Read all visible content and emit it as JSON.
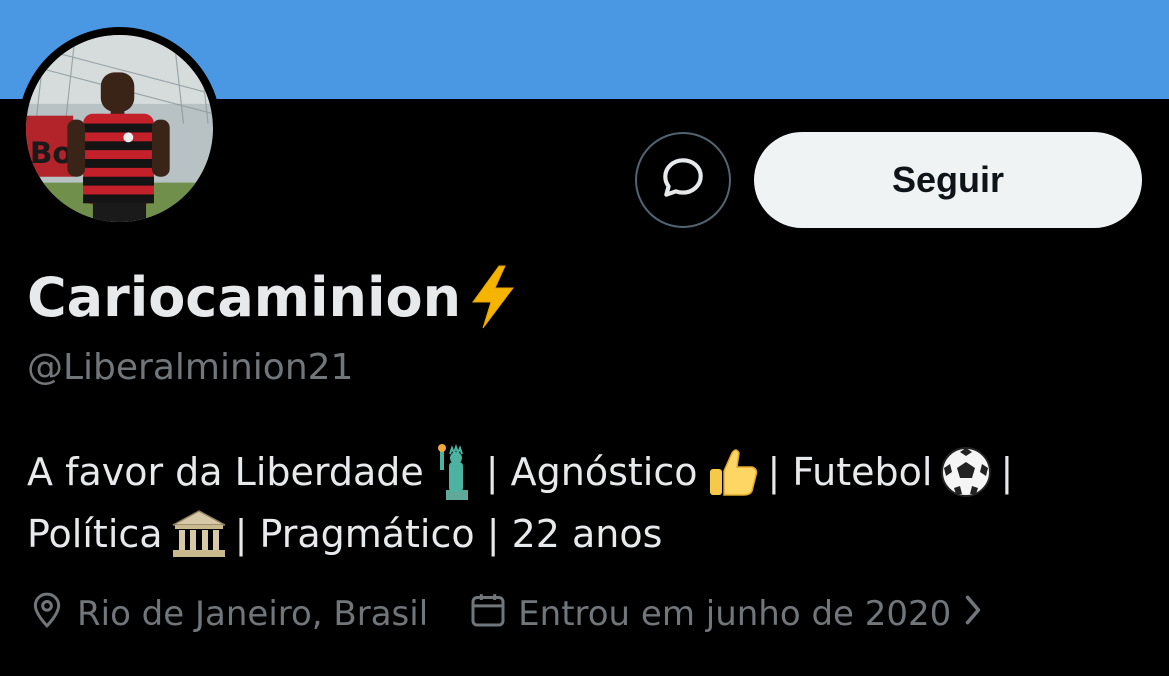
{
  "profile": {
    "display_name": "Cariocaminion",
    "name_emoji": "lightning-bolt-emoji",
    "handle": "@Liberalminion21",
    "avatar_icon": "profile-photo",
    "banner_color": "#4a98e4"
  },
  "actions": {
    "message_icon": "message-bubble-icon",
    "follow_label": "Seguir"
  },
  "bio": {
    "line1": {
      "part1": "A favor da Liberdade",
      "emoji1": "statue-of-liberty-emoji",
      "part2": "| Agnóstico",
      "emoji2": "thumbs-up-emoji",
      "part3": "| Futebol",
      "emoji3": "soccer-ball-emoji",
      "part4": "|"
    },
    "line2": {
      "part1": "Política",
      "emoji1": "classical-building-emoji",
      "part2": "| Pragmático | 22 anos"
    }
  },
  "meta": {
    "location": "Rio de Janeiro, Brasil",
    "location_icon": "location-pin-icon",
    "joined": "Entrou em junho de 2020",
    "joined_icon": "calendar-icon",
    "chevron_icon": "chevron-right-icon"
  },
  "colors": {
    "background": "#000000",
    "primary_text": "#e7e9ea",
    "secondary_text": "#71767b",
    "button_bg": "#eff3f4"
  }
}
